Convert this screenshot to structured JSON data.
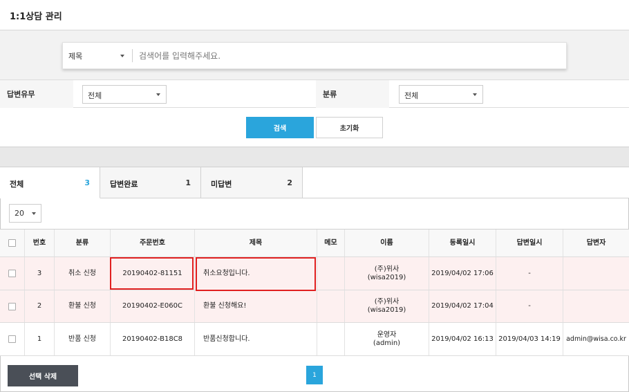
{
  "header": {
    "title": "1:1상담 관리"
  },
  "search": {
    "field_selected": "제목",
    "placeholder": "검색어를 입력해주세요."
  },
  "filters": {
    "answer_status": {
      "label": "답변유무",
      "selected": "전체"
    },
    "category": {
      "label": "분류",
      "selected": "전체"
    }
  },
  "buttons": {
    "search_label": "검색",
    "reset_label": "초기화",
    "delete_label": "선택 삭제"
  },
  "tabs": [
    {
      "label": "전체",
      "count": "3"
    },
    {
      "label": "답변완료",
      "count": "1"
    },
    {
      "label": "미답변",
      "count": "2"
    }
  ],
  "page_size": "20",
  "table": {
    "columns": [
      "번호",
      "분류",
      "주문번호",
      "제목",
      "메모",
      "이름",
      "등록일시",
      "답변일시",
      "답변자"
    ],
    "rows": [
      {
        "no": "3",
        "category": "취소 신청",
        "order_no": "20190402-81151",
        "subject": "취소요청입니다.",
        "memo": "",
        "name": "(주)위사",
        "user_id": "(wisa2019)",
        "created": "2019/04/02 17:06",
        "answered": "-",
        "answerer": ""
      },
      {
        "no": "2",
        "category": "환불 신청",
        "order_no": "20190402-E060C",
        "subject": "환불 신청해요!",
        "memo": "",
        "name": "(주)위사",
        "user_id": "(wisa2019)",
        "created": "2019/04/02 17:04",
        "answered": "-",
        "answerer": ""
      },
      {
        "no": "1",
        "category": "반품 신청",
        "order_no": "20190402-B18C8",
        "subject": "반품신청합니다.",
        "memo": "",
        "name": "운영자",
        "user_id": "(admin)",
        "created": "2019/04/02 16:13",
        "answered": "2019/04/03 14:19",
        "answerer": "admin@wisa.co.kr"
      }
    ]
  },
  "pagination": {
    "current": "1"
  },
  "colors": {
    "accent": "#2aa5dc",
    "highlight": "#e02020",
    "row_pending": "#fdf0f0",
    "dark_button": "#4a4f57"
  }
}
